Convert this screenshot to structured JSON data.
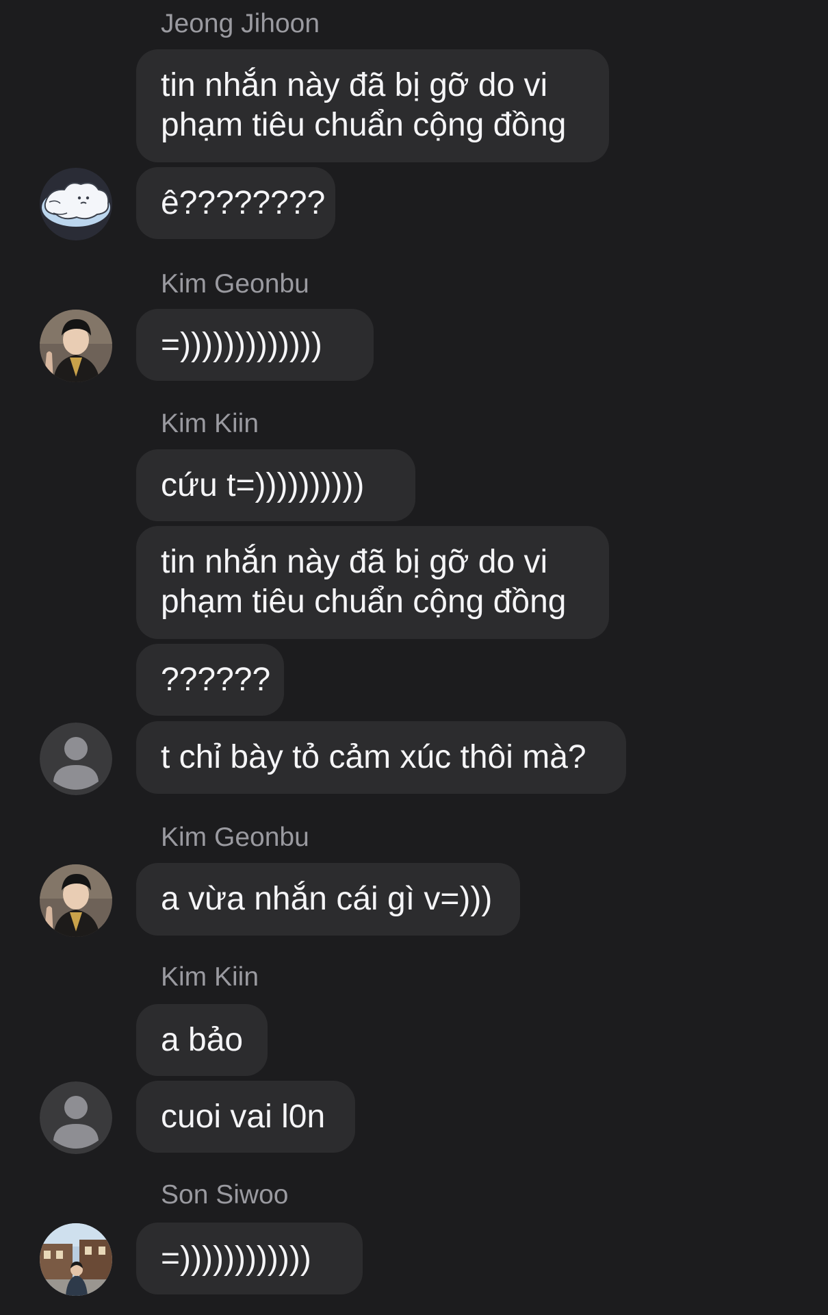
{
  "messages": [
    {
      "sender": "Jeong Jihoon"
    },
    {
      "text": "tin nhắn này đã bị gỡ do vi phạm tiêu chuẩn cộng đồng"
    },
    {
      "text": "ê????????",
      "avatar": "cloud-avatar-icon"
    },
    {
      "sender": "Kim Geonbu"
    },
    {
      "text": "=)))))))))))))",
      "avatar": "geonbu-photo-avatar"
    },
    {
      "sender": "Kim Kiin"
    },
    {
      "text": "cứu t=))))))))))"
    },
    {
      "text": "tin nhắn này đã bị gỡ do vi phạm tiêu chuẩn cộng đồng"
    },
    {
      "text": "??????"
    },
    {
      "text": "t chỉ bày tỏ cảm xúc thôi mà?",
      "avatar": "default-person-icon"
    },
    {
      "sender": "Kim Geonbu"
    },
    {
      "text": "a vừa nhắn cái gì v=)))",
      "avatar": "geonbu-photo-avatar"
    },
    {
      "sender": "Kim Kiin"
    },
    {
      "text": "a bảo"
    },
    {
      "text": "cuoi vai l0n",
      "avatar": "default-person-icon"
    },
    {
      "sender": "Son Siwoo"
    },
    {
      "text": "=))))))))))))",
      "avatar": "siwoo-photo-avatar"
    }
  ],
  "colors": {
    "background": "#1c1c1e",
    "bubble": "#2c2c2e",
    "sender_name": "#9a9aa0",
    "text": "#f5f5f7"
  }
}
